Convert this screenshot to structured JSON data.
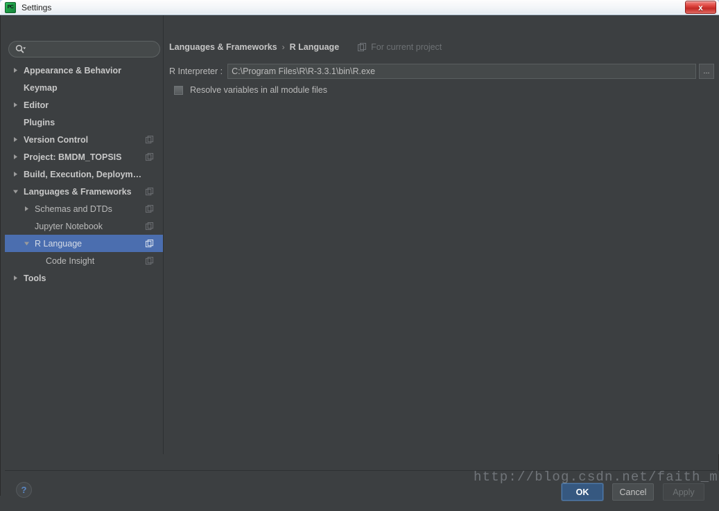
{
  "window": {
    "title": "Settings",
    "app_icon": "pycharm-icon",
    "close_label": "x"
  },
  "search": {
    "value": "",
    "placeholder": "",
    "icon": "search-icon"
  },
  "sidebar": {
    "items": [
      {
        "label": "Appearance & Behavior",
        "arrow": "right",
        "indent": 0,
        "bold": true,
        "module": false,
        "selected": false
      },
      {
        "label": "Keymap",
        "arrow": "none",
        "indent": 0,
        "bold": true,
        "module": false,
        "selected": false
      },
      {
        "label": "Editor",
        "arrow": "right",
        "indent": 0,
        "bold": true,
        "module": false,
        "selected": false
      },
      {
        "label": "Plugins",
        "arrow": "none",
        "indent": 0,
        "bold": true,
        "module": false,
        "selected": false
      },
      {
        "label": "Version Control",
        "arrow": "right",
        "indent": 0,
        "bold": true,
        "module": true,
        "selected": false
      },
      {
        "label": "Project: BMDM_TOPSIS",
        "arrow": "right",
        "indent": 0,
        "bold": true,
        "module": true,
        "selected": false
      },
      {
        "label": "Build, Execution, Deployment",
        "arrow": "right",
        "indent": 0,
        "bold": true,
        "module": false,
        "selected": false
      },
      {
        "label": "Languages & Frameworks",
        "arrow": "down",
        "indent": 0,
        "bold": true,
        "module": true,
        "selected": false
      },
      {
        "label": "Schemas and DTDs",
        "arrow": "right",
        "indent": 1,
        "bold": false,
        "module": true,
        "selected": false
      },
      {
        "label": "Jupyter Notebook",
        "arrow": "none",
        "indent": 1,
        "bold": false,
        "module": true,
        "selected": false
      },
      {
        "label": "R Language",
        "arrow": "down",
        "indent": 1,
        "bold": false,
        "module": true,
        "selected": true
      },
      {
        "label": "Code Insight",
        "arrow": "none",
        "indent": 2,
        "bold": false,
        "module": true,
        "selected": false
      },
      {
        "label": "Tools",
        "arrow": "right",
        "indent": 0,
        "bold": true,
        "module": false,
        "selected": false
      }
    ]
  },
  "main": {
    "breadcrumb": {
      "parent": "Languages & Frameworks",
      "separator": "›",
      "current": "R Language"
    },
    "scope_note": {
      "icon": "module-icon",
      "text": "For current project"
    },
    "interpreter": {
      "label": "R Interpreter :",
      "value": "C:\\Program Files\\R\\R-3.3.1\\bin\\R.exe",
      "placeholder": "",
      "browse_label": "..."
    },
    "resolve_variables": {
      "label": "Resolve variables in all module files",
      "checked": false
    }
  },
  "footer": {
    "help_label": "?",
    "ok_label": "OK",
    "cancel_label": "Cancel",
    "apply_label": "Apply"
  },
  "watermark": {
    "text": "http://blog.csdn.net/faith_mo_blog"
  },
  "colors": {
    "background": "#3c3f41",
    "selection": "#4b6eaf",
    "field_background": "#45494a",
    "text": "#bbbbbb",
    "ok_button": "#365880",
    "close_button": "#c32a26",
    "help_icon": "#5b87c4"
  }
}
